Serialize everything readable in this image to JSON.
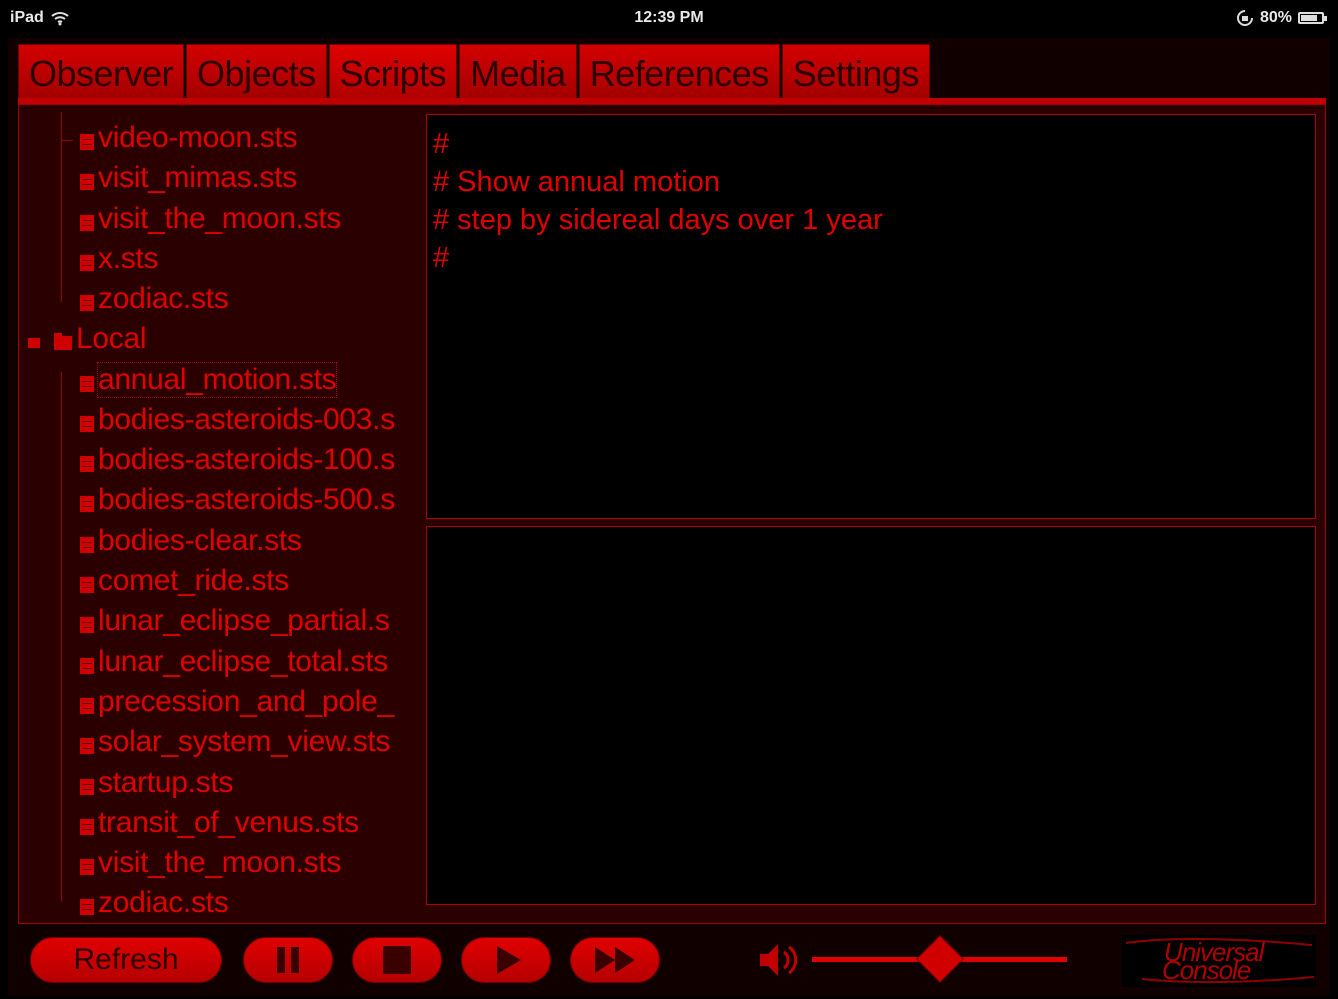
{
  "status_bar": {
    "device": "iPad",
    "time": "12:39 PM",
    "battery": "80%",
    "battery_level": 0.8
  },
  "tabs": [
    {
      "label": "Observer"
    },
    {
      "label": "Objects"
    },
    {
      "label": "Scripts"
    },
    {
      "label": "Media"
    },
    {
      "label": "References"
    },
    {
      "label": "Settings"
    }
  ],
  "active_tab": "Scripts",
  "tree": {
    "group1_items": [
      {
        "label": "video-moon.sts"
      },
      {
        "label": "visit_mimas.sts"
      },
      {
        "label": "visit_the_moon.sts"
      },
      {
        "label": "x.sts"
      },
      {
        "label": "zodiac.sts"
      }
    ],
    "local_folder": {
      "label": "Local"
    },
    "local_items": [
      {
        "label": "annual_motion.sts"
      },
      {
        "label": "bodies-asteroids-003.s"
      },
      {
        "label": "bodies-asteroids-100.s"
      },
      {
        "label": "bodies-asteroids-500.s"
      },
      {
        "label": "bodies-clear.sts"
      },
      {
        "label": "comet_ride.sts"
      },
      {
        "label": "lunar_eclipse_partial.s"
      },
      {
        "label": "lunar_eclipse_total.sts"
      },
      {
        "label": "precession_and_pole_"
      },
      {
        "label": "solar_system_view.sts"
      },
      {
        "label": "startup.sts"
      },
      {
        "label": "transit_of_venus.sts"
      },
      {
        "label": "visit_the_moon.sts"
      },
      {
        "label": "zodiac.sts"
      }
    ],
    "selected": "annual_motion.sts"
  },
  "script_text": {
    "lines": [
      "#",
      "# Show annual motion",
      "# step by sidereal days over 1 year",
      "#"
    ]
  },
  "controls": {
    "refresh_label": "Refresh",
    "volume_level": 0.5
  },
  "logo": {
    "line1": "Universal",
    "line2": "Console"
  }
}
